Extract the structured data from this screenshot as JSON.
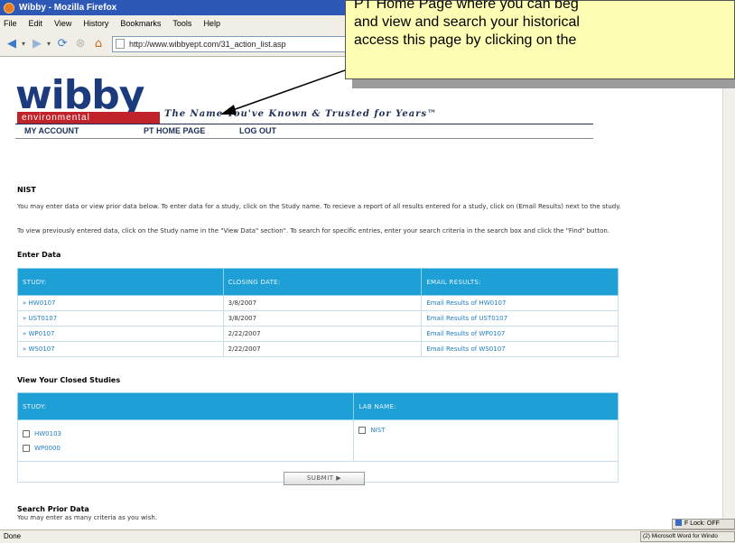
{
  "browser": {
    "title": "Wibby - Mozilla Firefox",
    "menu": [
      "File",
      "Edit",
      "View",
      "History",
      "Bookmarks",
      "Tools",
      "Help"
    ],
    "url": "http://www.wibbyept.com/31_action_list.asp",
    "status": "Done"
  },
  "site": {
    "logo_word": "wibby",
    "logo_sub": "environmental",
    "tagline": "The Name You've Known & Trusted for Years™",
    "nav": [
      "MY ACCOUNT",
      "PT HOME PAGE",
      "LOG OUT"
    ]
  },
  "page": {
    "title": "NIST",
    "intro1": "You may enter data or view prior data below. To enter data for a study, click on the Study name. To recieve a report of all results entered for a study, click on (Email Results) next to the study.",
    "intro2": "To view previously entered data, click on the Study name in the \"View Data\" section\". To search for specific entries, enter your search criteria in the search box and click the \"Find\" button."
  },
  "enter_data": {
    "heading": "Enter Data",
    "columns": [
      "STUDY:",
      "CLOSING DATE:",
      "EMAIL RESULTS:"
    ],
    "rows": [
      {
        "study": "HW0107",
        "date": "3/8/2007",
        "email": "Email Results of HW0107"
      },
      {
        "study": "UST0107",
        "date": "3/8/2007",
        "email": "Email Results of UST0107"
      },
      {
        "study": "WP0107",
        "date": "2/22/2007",
        "email": "Email Results of WP0107"
      },
      {
        "study": "WS0107",
        "date": "2/22/2007",
        "email": "Email Results of WS0107"
      }
    ]
  },
  "closed": {
    "heading": "View Your Closed Studies",
    "columns": [
      "STUDY:",
      "LAB NAME:"
    ],
    "studies": [
      "HW0103",
      "WP0000"
    ],
    "lab": "NIST",
    "submit_label": "SUBMIT ▶"
  },
  "search": {
    "heading": "Search Prior Data",
    "hint": "You may enter as many criteria as you wish."
  },
  "callout": {
    "lines": [
      "PT Home Page where you can beg",
      "and view and search your historical",
      "access this page by clicking on the"
    ]
  },
  "system": {
    "flock": "F Lock: OFF",
    "task": "(2) Microsoft Word for Windo"
  }
}
